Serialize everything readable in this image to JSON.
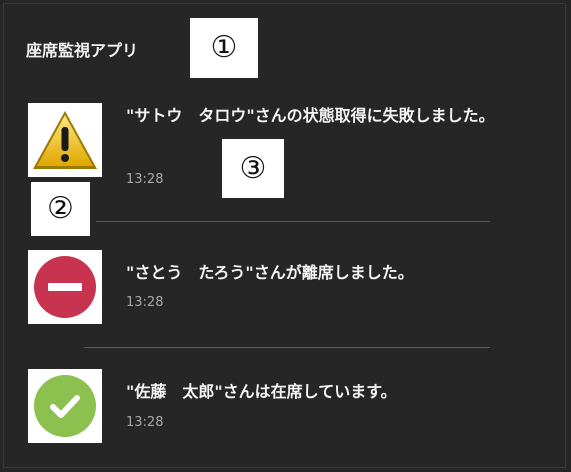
{
  "app": {
    "title": "座席監視アプリ"
  },
  "callouts": [
    "①",
    "②",
    "③"
  ],
  "notifications": [
    {
      "icon": "warning-icon",
      "message": "\"サトウ　タロウ\"さんの状態取得に失敗しました。",
      "time": "13:28"
    },
    {
      "icon": "no-entry-icon",
      "message": "\"さとう　たろう\"さんが離席しました。",
      "time": "13:28"
    },
    {
      "icon": "checkmark-icon",
      "message": "\"佐藤　太郎\"さんは在席しています。",
      "time": "13:28"
    }
  ],
  "colors": {
    "background": "#262626",
    "warning_yellow": "#f2c21b",
    "away_red": "#c8334f",
    "present_green": "#8cc04f"
  }
}
